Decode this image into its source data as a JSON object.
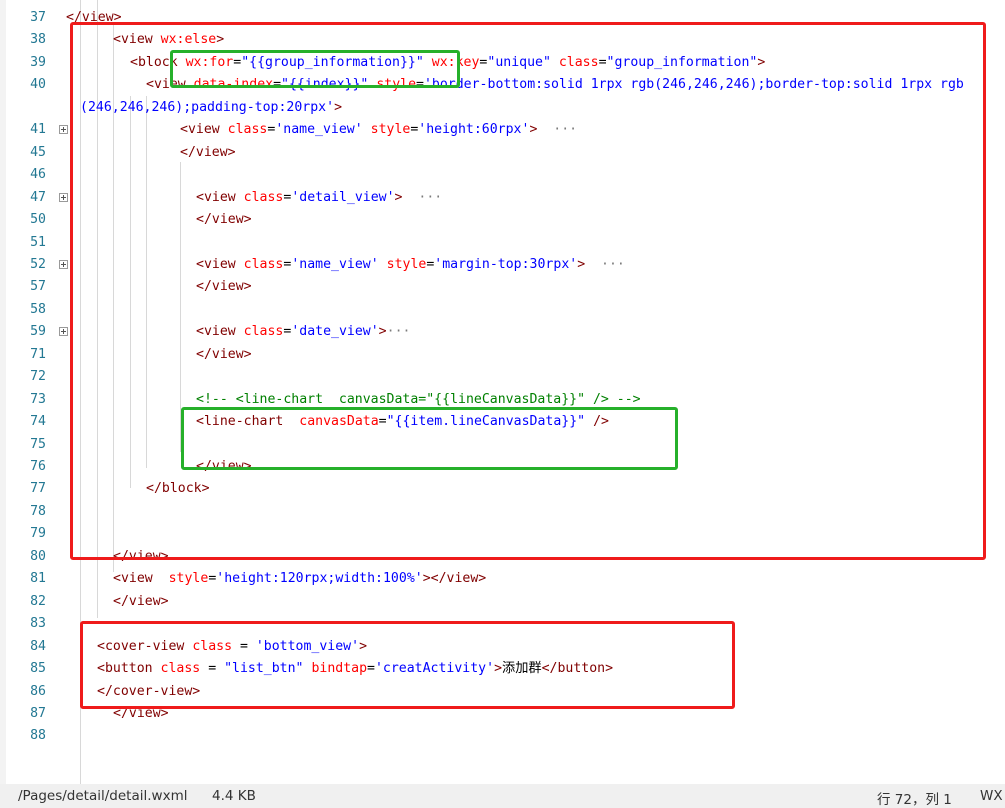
{
  "editor": {
    "lines": [
      {
        "n": "37",
        "tokens": [
          {
            "c": "p",
            "t": "</view>"
          }
        ]
      },
      {
        "n": "38",
        "tokens": [
          {
            "c": "p",
            "t": "<"
          },
          {
            "c": "t",
            "t": "view"
          },
          {
            "c": "x",
            "t": " "
          },
          {
            "c": "a",
            "t": "wx:else"
          },
          {
            "c": "p",
            "t": ">"
          }
        ]
      },
      {
        "n": "39",
        "tokens": [
          {
            "c": "p",
            "t": "<"
          },
          {
            "c": "t",
            "t": "block"
          },
          {
            "c": "x",
            "t": " "
          },
          {
            "c": "a",
            "t": "wx:for"
          },
          {
            "c": "x",
            "t": "="
          },
          {
            "c": "v",
            "t": "\"{{group_information}}\""
          },
          {
            "c": "x",
            "t": " "
          },
          {
            "c": "a",
            "t": "wx:key"
          },
          {
            "c": "x",
            "t": "="
          },
          {
            "c": "v",
            "t": "\"unique\""
          },
          {
            "c": "x",
            "t": " "
          },
          {
            "c": "a",
            "t": "class"
          },
          {
            "c": "x",
            "t": "="
          },
          {
            "c": "v",
            "t": "\"group_information\""
          },
          {
            "c": "p",
            "t": ">"
          }
        ]
      },
      {
        "n": "40",
        "tokens": [
          {
            "c": "p",
            "t": "<"
          },
          {
            "c": "t",
            "t": "view"
          },
          {
            "c": "x",
            "t": " "
          },
          {
            "c": "a",
            "t": "data-index"
          },
          {
            "c": "x",
            "t": "="
          },
          {
            "c": "v",
            "t": "\"{{index}}\""
          },
          {
            "c": "x",
            "t": " "
          },
          {
            "c": "a",
            "t": "style"
          },
          {
            "c": "x",
            "t": "="
          },
          {
            "c": "v",
            "t": "'border-bottom:solid 1rpx rgb(246,246,246);border-top:solid 1rpx rgb"
          }
        ]
      },
      {
        "n": "",
        "tokens": [
          {
            "c": "v",
            "t": "(246,246,246);padding-top:20rpx'"
          },
          {
            "c": "p",
            "t": ">"
          }
        ]
      },
      {
        "n": "41",
        "fold": true,
        "tokens": [
          {
            "c": "p",
            "t": "<"
          },
          {
            "c": "t",
            "t": "view"
          },
          {
            "c": "x",
            "t": " "
          },
          {
            "c": "a",
            "t": "class"
          },
          {
            "c": "x",
            "t": "="
          },
          {
            "c": "v",
            "t": "'name_view'"
          },
          {
            "c": "x",
            "t": " "
          },
          {
            "c": "a",
            "t": "style"
          },
          {
            "c": "x",
            "t": "="
          },
          {
            "c": "v",
            "t": "'height:60rpx'"
          },
          {
            "c": "p",
            "t": ">"
          },
          {
            "c": "el",
            "t": "  ···"
          }
        ]
      },
      {
        "n": "45",
        "tokens": [
          {
            "c": "p",
            "t": "</"
          },
          {
            "c": "t",
            "t": "view"
          },
          {
            "c": "p",
            "t": ">"
          }
        ]
      },
      {
        "n": "46",
        "tokens": []
      },
      {
        "n": "47",
        "fold": true,
        "tokens": [
          {
            "c": "p",
            "t": "<"
          },
          {
            "c": "t",
            "t": "view"
          },
          {
            "c": "x",
            "t": " "
          },
          {
            "c": "a",
            "t": "class"
          },
          {
            "c": "x",
            "t": "="
          },
          {
            "c": "v",
            "t": "'detail_view'"
          },
          {
            "c": "p",
            "t": ">"
          },
          {
            "c": "el",
            "t": "  ···"
          }
        ]
      },
      {
        "n": "50",
        "tokens": [
          {
            "c": "p",
            "t": "</"
          },
          {
            "c": "t",
            "t": "view"
          },
          {
            "c": "p",
            "t": ">"
          }
        ]
      },
      {
        "n": "51",
        "tokens": []
      },
      {
        "n": "52",
        "fold": true,
        "tokens": [
          {
            "c": "p",
            "t": "<"
          },
          {
            "c": "t",
            "t": "view"
          },
          {
            "c": "x",
            "t": " "
          },
          {
            "c": "a",
            "t": "class"
          },
          {
            "c": "x",
            "t": "="
          },
          {
            "c": "v",
            "t": "'name_view'"
          },
          {
            "c": "x",
            "t": " "
          },
          {
            "c": "a",
            "t": "style"
          },
          {
            "c": "x",
            "t": "="
          },
          {
            "c": "v",
            "t": "'margin-top:30rpx'"
          },
          {
            "c": "p",
            "t": ">"
          },
          {
            "c": "el",
            "t": "  ···"
          }
        ]
      },
      {
        "n": "57",
        "tokens": [
          {
            "c": "p",
            "t": "</"
          },
          {
            "c": "t",
            "t": "view"
          },
          {
            "c": "p",
            "t": ">"
          }
        ]
      },
      {
        "n": "58",
        "tokens": []
      },
      {
        "n": "59",
        "fold": true,
        "tokens": [
          {
            "c": "p",
            "t": "<"
          },
          {
            "c": "t",
            "t": "view"
          },
          {
            "c": "x",
            "t": " "
          },
          {
            "c": "a",
            "t": "class"
          },
          {
            "c": "x",
            "t": "="
          },
          {
            "c": "v",
            "t": "'date_view'"
          },
          {
            "c": "p",
            "t": ">"
          },
          {
            "c": "el",
            "t": "···"
          }
        ]
      },
      {
        "n": "71",
        "tokens": [
          {
            "c": "p",
            "t": "</"
          },
          {
            "c": "t",
            "t": "view"
          },
          {
            "c": "p",
            "t": ">"
          }
        ]
      },
      {
        "n": "72",
        "tokens": []
      },
      {
        "n": "73",
        "tokens": [
          {
            "c": "cm",
            "t": "<!-- <line-chart  canvasData=\"{{lineCanvasData}}\" /> -->"
          }
        ]
      },
      {
        "n": "74",
        "tokens": [
          {
            "c": "p",
            "t": "<"
          },
          {
            "c": "t",
            "t": "line-chart"
          },
          {
            "c": "x",
            "t": "  "
          },
          {
            "c": "a",
            "t": "canvasData"
          },
          {
            "c": "x",
            "t": "="
          },
          {
            "c": "v",
            "t": "\"{{item.lineCanvasData}}\""
          },
          {
            "c": "x",
            "t": " "
          },
          {
            "c": "p",
            "t": "/>"
          }
        ]
      },
      {
        "n": "75",
        "tokens": []
      },
      {
        "n": "76",
        "tokens": [
          {
            "c": "p",
            "t": "</"
          },
          {
            "c": "t",
            "t": "view"
          },
          {
            "c": "p",
            "t": ">"
          }
        ]
      },
      {
        "n": "77",
        "tokens": [
          {
            "c": "p",
            "t": "</"
          },
          {
            "c": "t",
            "t": "block"
          },
          {
            "c": "p",
            "t": ">"
          }
        ]
      },
      {
        "n": "78",
        "tokens": []
      },
      {
        "n": "79",
        "tokens": []
      },
      {
        "n": "80",
        "tokens": [
          {
            "c": "p",
            "t": "</"
          },
          {
            "c": "t",
            "t": "view"
          },
          {
            "c": "p",
            "t": ">"
          }
        ]
      },
      {
        "n": "81",
        "tokens": [
          {
            "c": "p",
            "t": "<"
          },
          {
            "c": "t",
            "t": "view"
          },
          {
            "c": "x",
            "t": "  "
          },
          {
            "c": "a",
            "t": "style"
          },
          {
            "c": "x",
            "t": "="
          },
          {
            "c": "v",
            "t": "'height:120rpx;width:100%'"
          },
          {
            "c": "p",
            "t": "></"
          },
          {
            "c": "t",
            "t": "view"
          },
          {
            "c": "p",
            "t": ">"
          }
        ]
      },
      {
        "n": "82",
        "tokens": [
          {
            "c": "p",
            "t": "</"
          },
          {
            "c": "t",
            "t": "view"
          },
          {
            "c": "p",
            "t": ">"
          }
        ]
      },
      {
        "n": "83",
        "tokens": []
      },
      {
        "n": "84",
        "tokens": [
          {
            "c": "p",
            "t": "<"
          },
          {
            "c": "t",
            "t": "cover-view"
          },
          {
            "c": "x",
            "t": " "
          },
          {
            "c": "a",
            "t": "class"
          },
          {
            "c": "x",
            "t": " = "
          },
          {
            "c": "v",
            "t": "'bottom_view'"
          },
          {
            "c": "p",
            "t": ">"
          }
        ]
      },
      {
        "n": "85",
        "tokens": [
          {
            "c": "p",
            "t": "<"
          },
          {
            "c": "t",
            "t": "button"
          },
          {
            "c": "x",
            "t": " "
          },
          {
            "c": "a",
            "t": "class"
          },
          {
            "c": "x",
            "t": " = "
          },
          {
            "c": "v",
            "t": "\"list_btn\""
          },
          {
            "c": "x",
            "t": " "
          },
          {
            "c": "a",
            "t": "bindtap"
          },
          {
            "c": "x",
            "t": "="
          },
          {
            "c": "v",
            "t": "'creatActivity'"
          },
          {
            "c": "p",
            "t": ">"
          },
          {
            "c": "x",
            "t": "添加群"
          },
          {
            "c": "p",
            "t": "</"
          },
          {
            "c": "t",
            "t": "button"
          },
          {
            "c": "p",
            "t": ">"
          }
        ]
      },
      {
        "n": "86",
        "tokens": [
          {
            "c": "p",
            "t": "</"
          },
          {
            "c": "t",
            "t": "cover-view"
          },
          {
            "c": "p",
            "t": ">"
          }
        ]
      },
      {
        "n": "87",
        "tokens": [
          {
            "c": "p",
            "t": "</"
          },
          {
            "c": "t",
            "t": "view"
          },
          {
            "c": "p",
            "t": ">"
          }
        ]
      },
      {
        "n": "88",
        "tokens": []
      }
    ]
  },
  "statusbar": {
    "file_path": "/Pages/detail/detail.wxml",
    "file_size": "4.4 KB",
    "cursor_position": "行 72，列 1",
    "file_type": "WX"
  },
  "colors": {
    "annotation_red": "#ef1b1b",
    "annotation_green": "#26b02a",
    "line_number": "#237893",
    "tag": "#800000",
    "attribute": "#ff0000",
    "value": "#0000ff",
    "comment": "#008000"
  }
}
